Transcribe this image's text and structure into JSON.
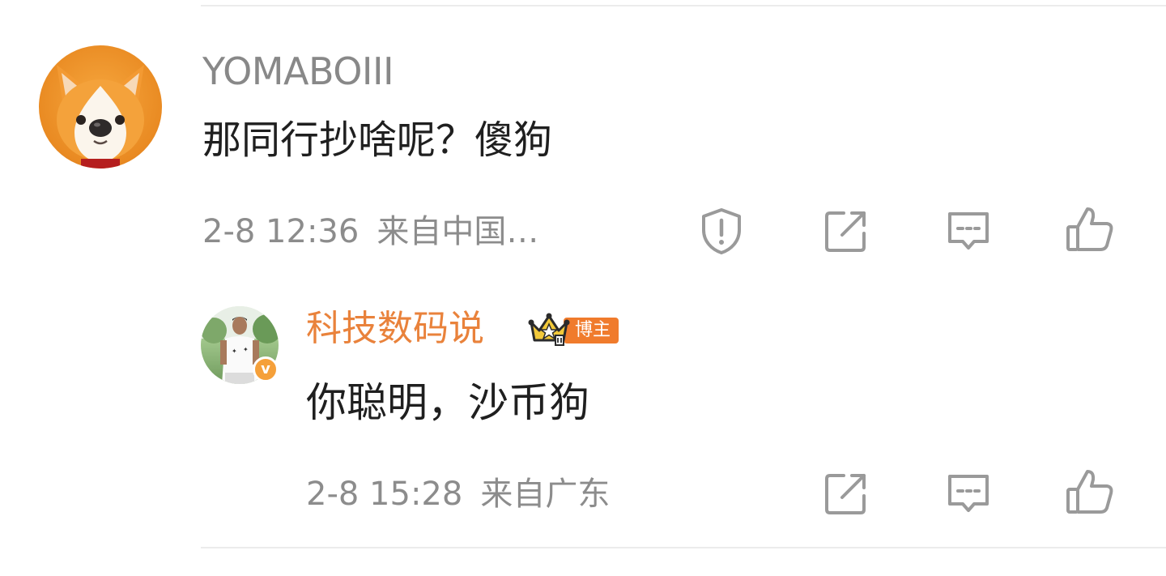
{
  "comment": {
    "username": "YOMABOIII",
    "text": "那同行抄啥呢？傻狗",
    "time": "2-8 12:36",
    "location": "来自中国…",
    "avatar_icon": "corgi-avatar",
    "actions": [
      "report-icon",
      "share-icon",
      "reply-icon",
      "like-icon"
    ]
  },
  "reply": {
    "username": "科技数码说",
    "badge_label": "博主",
    "badge_icon": "crown-badge-icon",
    "verified_mark": "v",
    "text": "你聪明，沙币狗",
    "time": "2-8 15:28",
    "location": "来自广东",
    "actions": [
      "share-icon",
      "reply-icon",
      "like-icon"
    ]
  },
  "colors": {
    "username_reply": "#e9823b",
    "meta_text": "#8c8c8c",
    "icon_stroke": "#9a9a9a",
    "badge_orange": "#f07b2c"
  }
}
